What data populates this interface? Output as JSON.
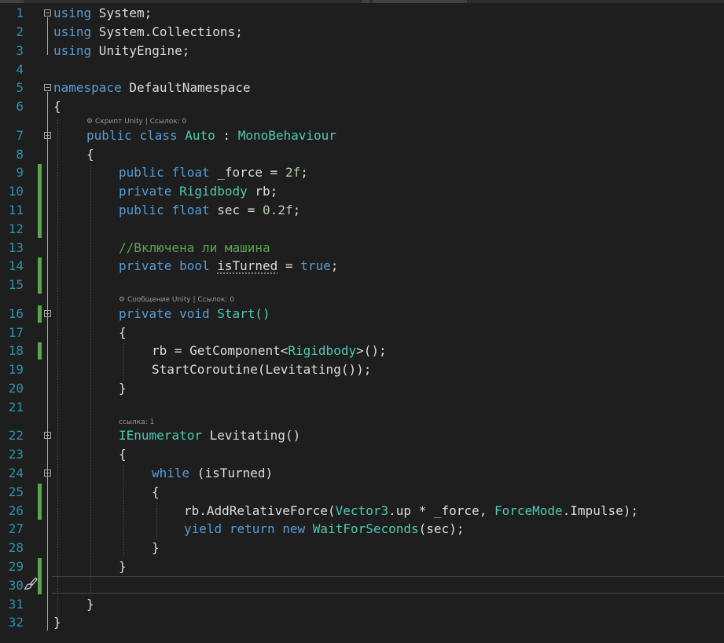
{
  "editor": {
    "line_numbers": [
      "1",
      "2",
      "3",
      "4",
      "5",
      "6",
      "7",
      "8",
      "9",
      "10",
      "11",
      "12",
      "13",
      "14",
      "15",
      "16",
      "17",
      "18",
      "19",
      "20",
      "21",
      "22",
      "23",
      "24",
      "25",
      "26",
      "27",
      "28",
      "29",
      "30",
      "31",
      "32"
    ],
    "code": {
      "l1_kw": "using",
      "l1_rest": " System;",
      "l2_kw": "using",
      "l2_rest": " System.Collections;",
      "l3_kw": "using",
      "l3_rest": " UnityEngine;",
      "l5_kw": "namespace",
      "l5_rest": " DefaultNamespace",
      "l6": "{",
      "l7_kw1": "public",
      "l7_kw2": "class",
      "l7_cls": "Auto",
      "l7_colon": " : ",
      "l7_base": "MonoBehaviour",
      "l8": "{",
      "l9_kw1": "public",
      "l9_kw2": "float",
      "l9_name": " _force = ",
      "l9_num": "2f",
      "l9_end": ";",
      "l10_kw": "private",
      "l10_type": "Rigidbody",
      "l10_rest": " rb;",
      "l11_kw1": "public",
      "l11_kw2": "float",
      "l11_name": " sec = ",
      "l11_num": "0.2f",
      "l11_end": ";",
      "l13_comment": "//Включена ли машина",
      "l14_kw1": "private",
      "l14_kw2": "bool",
      "l14_var": "isTurned",
      "l14_mid": " = ",
      "l14_val": "true",
      "l14_end": ";",
      "l16_kw1": "private",
      "l16_kw2": "void",
      "l16_name": " Start()",
      "l17": "{",
      "l18_a": "rb = GetComponent<",
      "l18_type": "Rigidbody",
      "l18_b": ">();",
      "l19": "StartCoroutine(Levitating());",
      "l20": "}",
      "l22_type": "IEnumerator",
      "l22_rest": " Levitating()",
      "l23": "{",
      "l24_kw": "while",
      "l24_rest": " (isTurned)",
      "l25": "{",
      "l26_a": "rb.AddRelativeForce(",
      "l26_t1": "Vector3",
      "l26_b": ".up * _force, ",
      "l26_t2": "ForceMode",
      "l26_c": ".Impulse);",
      "l27_kw1": "yield",
      "l27_kw2": "return",
      "l27_kw3": "new",
      "l27_type": "WaitForSeconds",
      "l27_rest": "(sec);",
      "l28": "}",
      "l29": "}",
      "l31": "}",
      "l32": "}"
    },
    "codelens": {
      "class_lens": "Скрипт Unity | Ссылок: 0",
      "start_lens": "Сообщение Unity | Ссылок: 0",
      "levitating_lens": "ссылка: 1"
    },
    "colors": {
      "background": "#1e1e1e",
      "line_number": "#2b91af",
      "keyword": "#569cd6",
      "type": "#4ec9b0",
      "number": "#b5cea8",
      "comment": "#57a64a",
      "text": "#dcdcdc",
      "change_bar": "#57a64a"
    },
    "icons": [
      "fold-collapse-icon",
      "paintbrush-icon",
      "unity-icon"
    ]
  }
}
